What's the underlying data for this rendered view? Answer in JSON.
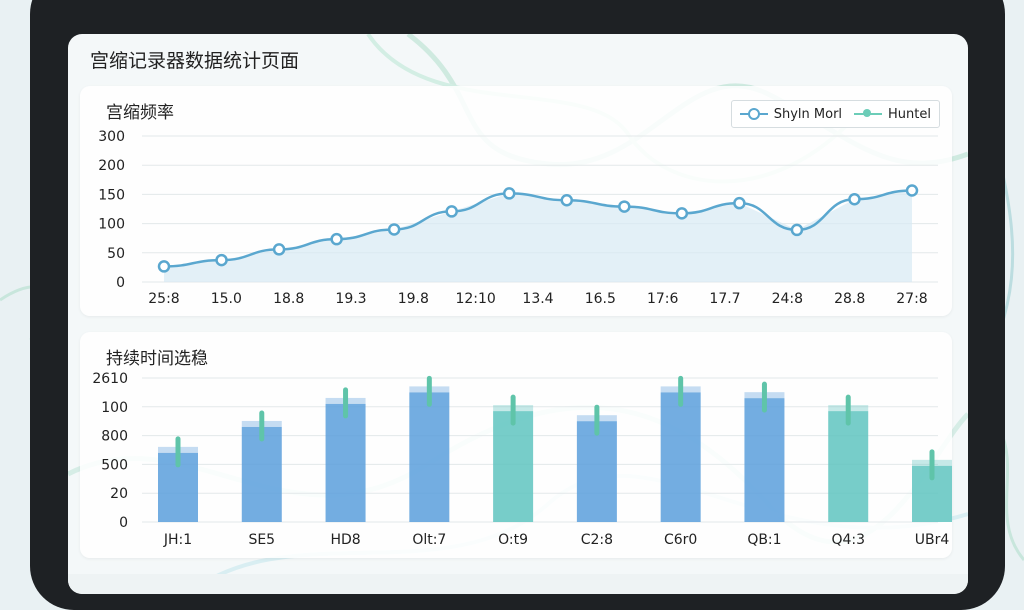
{
  "page": {
    "title": "宫缩记录器数据统计页面"
  },
  "colors": {
    "line": "#5aa7cf",
    "bar_blue": "#5b9fdc",
    "bar_teal": "#5fc4bf",
    "grid": "#e3e8ea",
    "accent_wave": "#a8dcc9"
  },
  "line_card": {
    "title": "宫缩频率",
    "legend": [
      {
        "label": "Shyln Morl",
        "color": "#5aa7cf",
        "icon": "line-circle-marker"
      },
      {
        "label": "Huntel",
        "color": "#6ccdb8",
        "icon": "line-dot-marker"
      }
    ]
  },
  "bar_card": {
    "title": "持续时间选稳"
  },
  "chart_data": [
    {
      "type": "line",
      "title": "宫缩频率",
      "y_tick_labels": [
        "0",
        "50",
        "100",
        "150",
        "200",
        "300"
      ],
      "x_tick_labels": [
        "25:8",
        "15.0",
        "18.8",
        "19.3",
        "19.8",
        "12:10",
        "13.4",
        "16.5",
        "17:6",
        "17.7",
        "24:8",
        "28.8",
        "27:8"
      ],
      "series": [
        {
          "name": "Shyln Morl",
          "color": "#5aa7cf",
          "points": [
            [
              0,
              32
            ],
            [
              1,
              45
            ],
            [
              2,
              67
            ],
            [
              3,
              88
            ],
            [
              4,
              108
            ],
            [
              5,
              145
            ],
            [
              6,
              182
            ],
            [
              7,
              168
            ],
            [
              8,
              155
            ],
            [
              9,
              141
            ],
            [
              10,
              162
            ],
            [
              11,
              107
            ],
            [
              12,
              170
            ],
            [
              13,
              188
            ]
          ]
        }
      ],
      "grid": true,
      "legend_position": "top-right"
    },
    {
      "type": "bar",
      "title": "持续时间选稳",
      "y_tick_labels": [
        "0",
        "20",
        "500",
        "800",
        "100",
        "2610"
      ],
      "categories": [
        "JH:1",
        "SE5",
        "HD8",
        "Olt:7",
        "O:t9",
        "C2:8",
        "C6r0",
        "QB:1",
        "Q4:3",
        "UBr4"
      ],
      "values": [
        48,
        66,
        82,
        90,
        77,
        70,
        90,
        86,
        77,
        39
      ],
      "colors": [
        "#5b9fdc",
        "#5b9fdc",
        "#5b9fdc",
        "#5b9fdc",
        "#5fc4bf",
        "#5b9fdc",
        "#5b9fdc",
        "#5b9fdc",
        "#5fc4bf",
        "#5fc4bf"
      ],
      "grid": true
    }
  ]
}
